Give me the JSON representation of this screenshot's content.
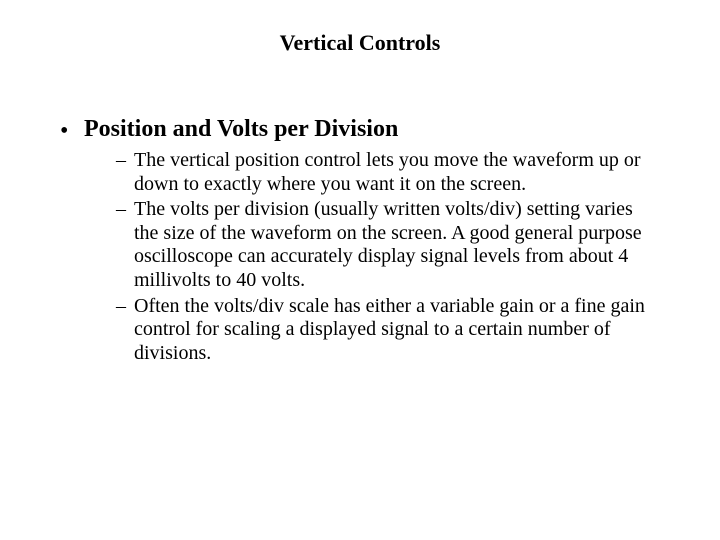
{
  "title": "Vertical Controls",
  "bullets": {
    "l1_0": "Position and Volts per Division",
    "l2_0": "The vertical position control lets you move the waveform up or down to exactly where you want it on the screen.",
    "l2_1": "The volts per division (usually written volts/div) setting varies the size of the waveform on the screen. A good general purpose oscilloscope can accurately display signal levels from about 4 millivolts to 40 volts.",
    "l2_2": "Often the volts/div scale has either a variable gain or a fine gain control for scaling a displayed signal to a certain number of divisions."
  }
}
